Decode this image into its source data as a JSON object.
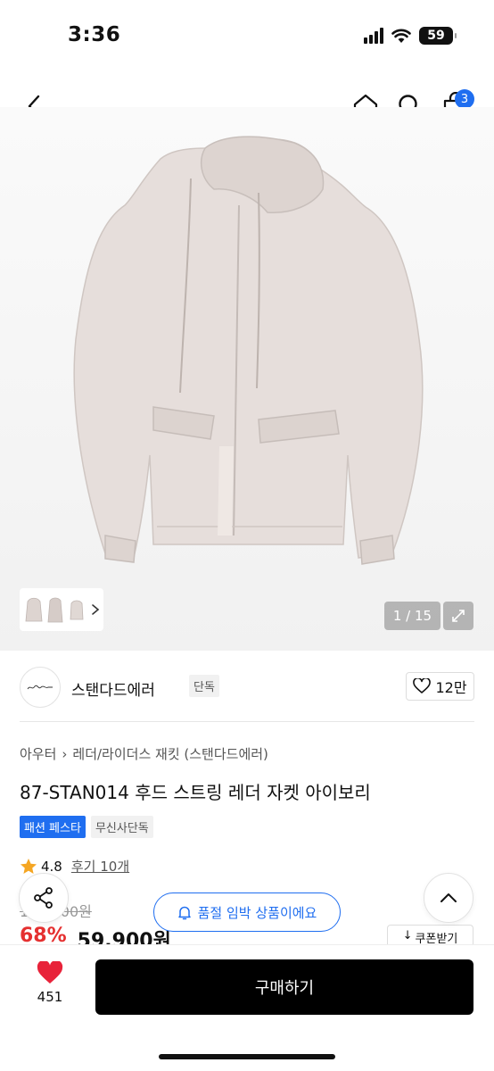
{
  "status": {
    "time": "3:36",
    "battery": "59"
  },
  "nav": {
    "cart_count": "3"
  },
  "gallery": {
    "counter": "1 / 15"
  },
  "brand": {
    "name": "스탠다드에러",
    "exclusive_tag": "단독",
    "likes": "12만"
  },
  "breadcrumb": {
    "category": "아우터",
    "subcategory": "레더/라이더스 재킷 (스탠다드에러)"
  },
  "product": {
    "title": "87-STAN014 후드 스트링 레더 자켓 아이보리",
    "tags": [
      "패션 페스타",
      "무신사단독"
    ],
    "rating": "4.8",
    "review_link": "후기 10개",
    "original_price": "189,900원",
    "discount": "68%",
    "sale_price": "59,900원"
  },
  "toast": {
    "text": "품절 임박 상품이에요"
  },
  "coupon": {
    "label": "쿠폰받기"
  },
  "bottom": {
    "heart_count": "451",
    "buy_label": "구매하기"
  },
  "colors": {
    "accent": "#1f6ef0",
    "sale": "#e53030",
    "heart": "#e8233a"
  }
}
